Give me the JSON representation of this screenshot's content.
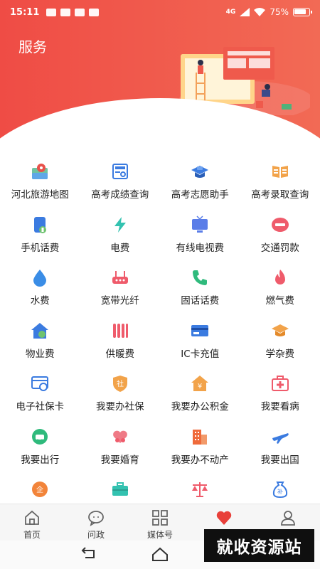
{
  "status_bar": {
    "time": "15:11",
    "network": "4G",
    "battery": "75%"
  },
  "page": {
    "title": "服务"
  },
  "services": [
    {
      "label": "河北旅游地图",
      "icon": "map-icon",
      "color": "#e8514a"
    },
    {
      "label": "高考成绩查询",
      "icon": "score-report-icon",
      "color": "#3b7be0"
    },
    {
      "label": "高考志愿助手",
      "icon": "ai-graduation-cap-icon",
      "color": "#3b7be0"
    },
    {
      "label": "高考录取查询",
      "icon": "open-book-icon",
      "color": "#f2a34a"
    },
    {
      "label": "手机话费",
      "icon": "mobile-phone-icon",
      "color": "#3b7be0"
    },
    {
      "label": "电费",
      "icon": "lightning-icon",
      "color": "#33c2b0"
    },
    {
      "label": "有线电视费",
      "icon": "tv-icon",
      "color": "#5a7de8"
    },
    {
      "label": "交通罚款",
      "icon": "no-entry-icon",
      "color": "#ef5b6b"
    },
    {
      "label": "水费",
      "icon": "water-drop-icon",
      "color": "#3a8de6"
    },
    {
      "label": "宽带光纤",
      "icon": "router-icon",
      "color": "#ef5b6b"
    },
    {
      "label": "固话话费",
      "icon": "telephone-icon",
      "color": "#2fba7c"
    },
    {
      "label": "燃气费",
      "icon": "flame-icon",
      "color": "#ef5b6b"
    },
    {
      "label": "物业费",
      "icon": "house-icon",
      "color": "#3b7be0"
    },
    {
      "label": "供暖费",
      "icon": "radiator-icon",
      "color": "#ef5b6b"
    },
    {
      "label": "IC卡充值",
      "icon": "ic-card-icon",
      "color": "#3b7be0"
    },
    {
      "label": "学杂费",
      "icon": "mortarboard-icon",
      "color": "#f2a34a"
    },
    {
      "label": "电子社保卡",
      "icon": "id-card-icon",
      "color": "#3b7be0"
    },
    {
      "label": "我要办社保",
      "icon": "shield-badge-icon",
      "color": "#f2a34a"
    },
    {
      "label": "我要办公积金",
      "icon": "housing-fund-icon",
      "color": "#f2a34a"
    },
    {
      "label": "我要看病",
      "icon": "medical-kit-icon",
      "color": "#ef5b6b"
    },
    {
      "label": "我要出行",
      "icon": "traffic-icon",
      "color": "#2fba7c"
    },
    {
      "label": "我要婚育",
      "icon": "family-icon",
      "color": "#ef5b6b"
    },
    {
      "label": "我要办不动产",
      "icon": "building-icon",
      "color": "#ef6a3a"
    },
    {
      "label": "我要出国",
      "icon": "airplane-icon",
      "color": "#3b7be0"
    },
    {
      "label": "",
      "icon": "enterprise-icon",
      "color": "#f2843a"
    },
    {
      "label": "",
      "icon": "briefcase-icon",
      "color": "#33c2b0"
    },
    {
      "label": "",
      "icon": "scales-icon",
      "color": "#ef5b6b"
    },
    {
      "label": "",
      "icon": "subsidy-bag-icon",
      "color": "#3b7be0"
    }
  ],
  "tabs": [
    {
      "label": "首页",
      "icon": "home-icon"
    },
    {
      "label": "问政",
      "icon": "chat-icon"
    },
    {
      "label": "媒体号",
      "icon": "grid-icon"
    },
    {
      "label": "",
      "icon": "heart-icon",
      "active": true
    },
    {
      "label": "",
      "icon": "profile-icon"
    }
  ],
  "watermark": "就收资源站",
  "colors": {
    "primary": "#ef4c45",
    "active_tab": "#e8403a"
  }
}
